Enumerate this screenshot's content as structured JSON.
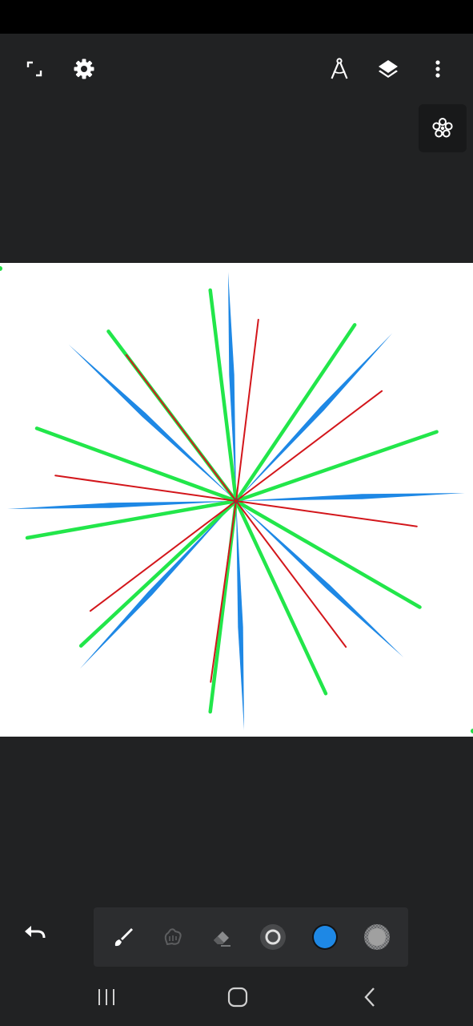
{
  "app": {
    "accent_color": "#1e88e5",
    "background_color": "#212223"
  },
  "top_bar": {
    "left_icons": [
      "fullscreen-icon",
      "gear-icon"
    ],
    "right_icons": [
      "drafting-compass-icon",
      "layers-icon",
      "more-vert-icon"
    ]
  },
  "symmetry_button": {
    "icon": "symmetry-flower-icon"
  },
  "canvas": {
    "background": "#ffffff",
    "center_dot_color": "#555555",
    "strokes": [
      {
        "color": "#1e88e5",
        "count": 8,
        "shape": "tapered",
        "angles_deg": [
          2,
          47,
          92,
          137,
          182,
          227,
          272,
          317
        ]
      },
      {
        "color": "#22e64a",
        "count": 10,
        "shape": "line",
        "angles_deg": [
          19,
          56,
          97,
          127,
          160,
          190,
          223,
          263,
          295,
          330
        ]
      },
      {
        "color": "#d3161b",
        "count": 8,
        "shape": "thin",
        "angles_deg": [
          37,
          83,
          127,
          172,
          217,
          262,
          307,
          352
        ]
      }
    ]
  },
  "bottom": {
    "undo_icon": "undo-icon",
    "tools": [
      {
        "name": "brush-icon",
        "state": "selected"
      },
      {
        "name": "smudge-icon",
        "state": "disabled"
      },
      {
        "name": "eraser-icon",
        "state": "normal"
      },
      {
        "name": "brush-size-icon",
        "state": "normal"
      },
      {
        "name": "color-swatch",
        "color": "#1e88e5"
      },
      {
        "name": "opacity-swatch",
        "color": "#a0a0a0"
      }
    ]
  },
  "nav_bar": {
    "buttons": [
      "recent-apps-icon",
      "home-icon",
      "back-icon"
    ]
  }
}
